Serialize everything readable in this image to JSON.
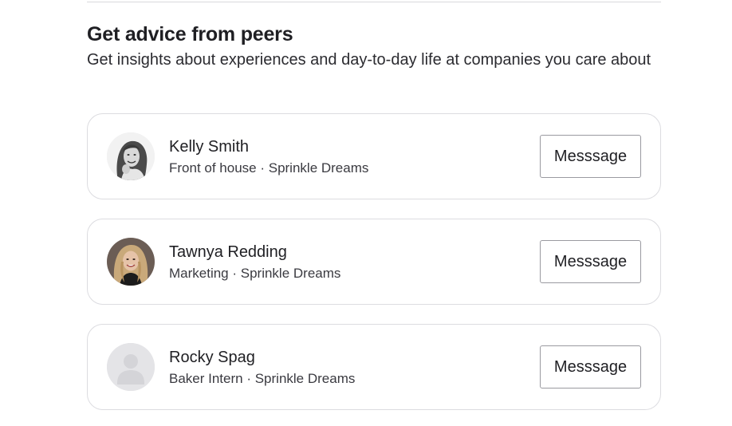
{
  "section": {
    "title": "Get advice from peers",
    "subtitle": "Get insights about experiences and day-to-day life at companies you care about"
  },
  "peers": [
    {
      "name": "Kelly Smith",
      "role": "Front of house",
      "company": "Sprinkle Dreams",
      "meta": "Front of house · Sprinkle Dreams",
      "button_label": "Messsage",
      "avatar": "photo-kelly"
    },
    {
      "name": "Tawnya Redding",
      "role": "Marketing",
      "company": "Sprinkle Dreams",
      "meta": "Marketing · Sprinkle Dreams",
      "button_label": "Messsage",
      "avatar": "photo-tawnya"
    },
    {
      "name": "Rocky Spag",
      "role": "Baker Intern",
      "company": "Sprinkle Dreams",
      "meta": "Baker Intern · Sprinkle Dreams",
      "button_label": "Messsage",
      "avatar": "default-user-icon"
    }
  ],
  "colors": {
    "text": "#1f1f23",
    "card_border": "#dcdce0",
    "button_border": "#9a9aa0",
    "placeholder_avatar": "#d4d4d8"
  }
}
